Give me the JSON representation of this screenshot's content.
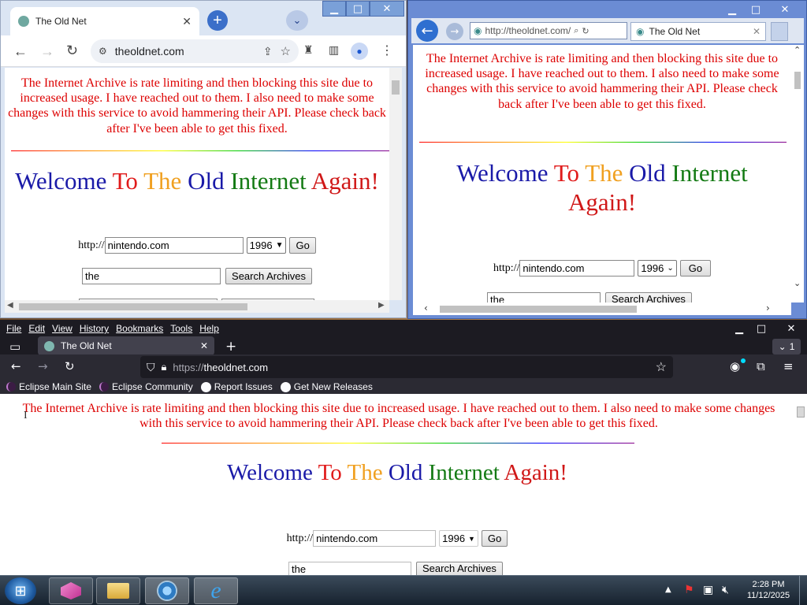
{
  "site": {
    "title": "The Old Net",
    "notice": "The Internet Archive is rate limiting and then blocking this site due to increased usage. I have reached out to them. I also need to make some changes with this service to avoid hammering their API. Please check back after I've been able to get this fixed.",
    "welcome": [
      "Welcome",
      "To",
      "The",
      "Old",
      "Internet",
      "Again!"
    ],
    "http_label": "http://",
    "url_value": "nintendo.com",
    "year_value": "1996",
    "go_label": "Go",
    "search_value": "the",
    "search_label": "Search Archives"
  },
  "chrome": {
    "tab_title": "The Old Net",
    "address": "theoldnet.com",
    "new_tab_glyph": "+"
  },
  "ie": {
    "address": "http://theoldnet.com/",
    "tab_title": "The Old Net"
  },
  "firefox": {
    "menu": [
      "File",
      "Edit",
      "View",
      "History",
      "Bookmarks",
      "Tools",
      "Help"
    ],
    "tab_title": "The Old Net",
    "url_scheme": "https://",
    "url_host": "theoldnet.com",
    "tab_count": "1",
    "bookmarks": [
      "Eclipse Main Site",
      "Eclipse Community",
      "Report Issues",
      "Get New Releases"
    ]
  },
  "taskbar": {
    "time": "2:28 PM",
    "date": "11/12/2025"
  },
  "icons": {
    "back": "arrow-left",
    "forward": "arrow-right",
    "reload": "reload",
    "star": "star",
    "share": "share",
    "extensions": "puzzle",
    "menu": "kebab"
  },
  "colors": {
    "notice": "#dd0000",
    "welcome_blue": "#1a1aa8",
    "welcome_red": "#e01b1b",
    "welcome_orange": "#f0a020",
    "welcome_green": "#137a13",
    "firefox_dark": "#1c1b22",
    "chrome_frame": "#dbe5f3"
  }
}
